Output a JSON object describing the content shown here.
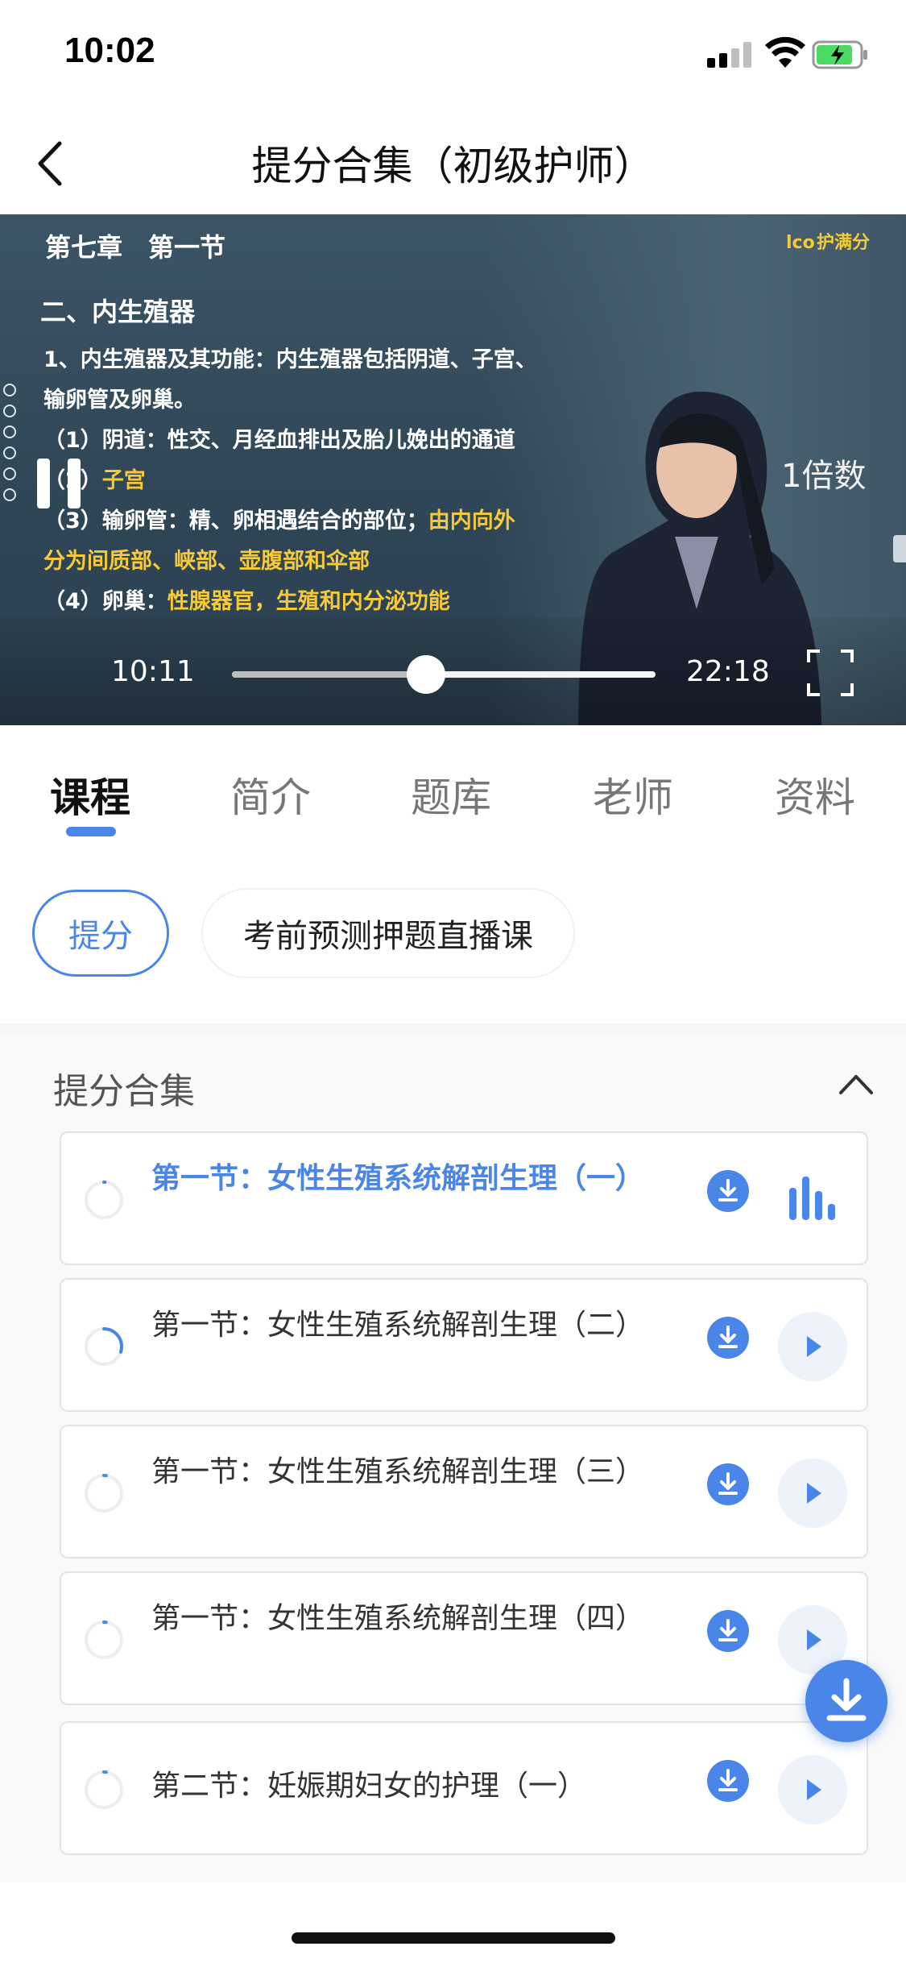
{
  "status_bar": {
    "time": "10:02"
  },
  "header": {
    "title": "提分合集（初级护师）"
  },
  "player": {
    "slide": {
      "chapter": "第七章　第一节",
      "heading": "二、内生殖器",
      "line1": "1、内生殖器及其功能：内生殖器包括阴道、子宫、",
      "line2": "输卵管及卵巢。",
      "line3": "（1）阴道：性交、月经血排出及胎儿娩出的通道",
      "line4_a": "（2）",
      "line4_b": "子宫",
      "line5_a": "（3）输卵管：精、卵相遇结合的部位；",
      "line5_b": "由内向外",
      "line6": "分为间质部、峡部、壶腹部和伞部",
      "line7_a": "（4）卵巢：",
      "line7_b": "性腺器官，生殖和内分泌功能"
    },
    "brand": "护满分",
    "speed": "1倍数",
    "current_time": "10:11",
    "total_time": "22:18",
    "progress": 0.459,
    "colors": {
      "highlight": "#f5c93a",
      "accent": "#4a86e8"
    }
  },
  "tabs": [
    "课程",
    "简介",
    "题库",
    "老师",
    "资料"
  ],
  "active_tab": 0,
  "chips": [
    "提分",
    "考前预测押题直播课"
  ],
  "section": {
    "title": "提分合集",
    "lessons": [
      {
        "title": "第一节：女性生殖系统解剖生理（一）",
        "state": "playing",
        "progress": 0.0
      },
      {
        "title": "第一节：女性生殖系统解剖生理（二）",
        "state": "idle",
        "progress": 0.3
      },
      {
        "title": "第一节：女性生殖系统解剖生理（三）",
        "state": "idle",
        "progress": 0.02
      },
      {
        "title": "第一节：女性生殖系统解剖生理（四）",
        "state": "idle",
        "progress": 0.02
      },
      {
        "title": "第二节：妊娠期妇女的护理（一）",
        "state": "idle",
        "progress": 0.02
      }
    ]
  },
  "icons": [
    "back-icon",
    "fullscreen-icon",
    "download-icon",
    "play-icon",
    "audio-bars-icon",
    "chevron-up-icon"
  ]
}
